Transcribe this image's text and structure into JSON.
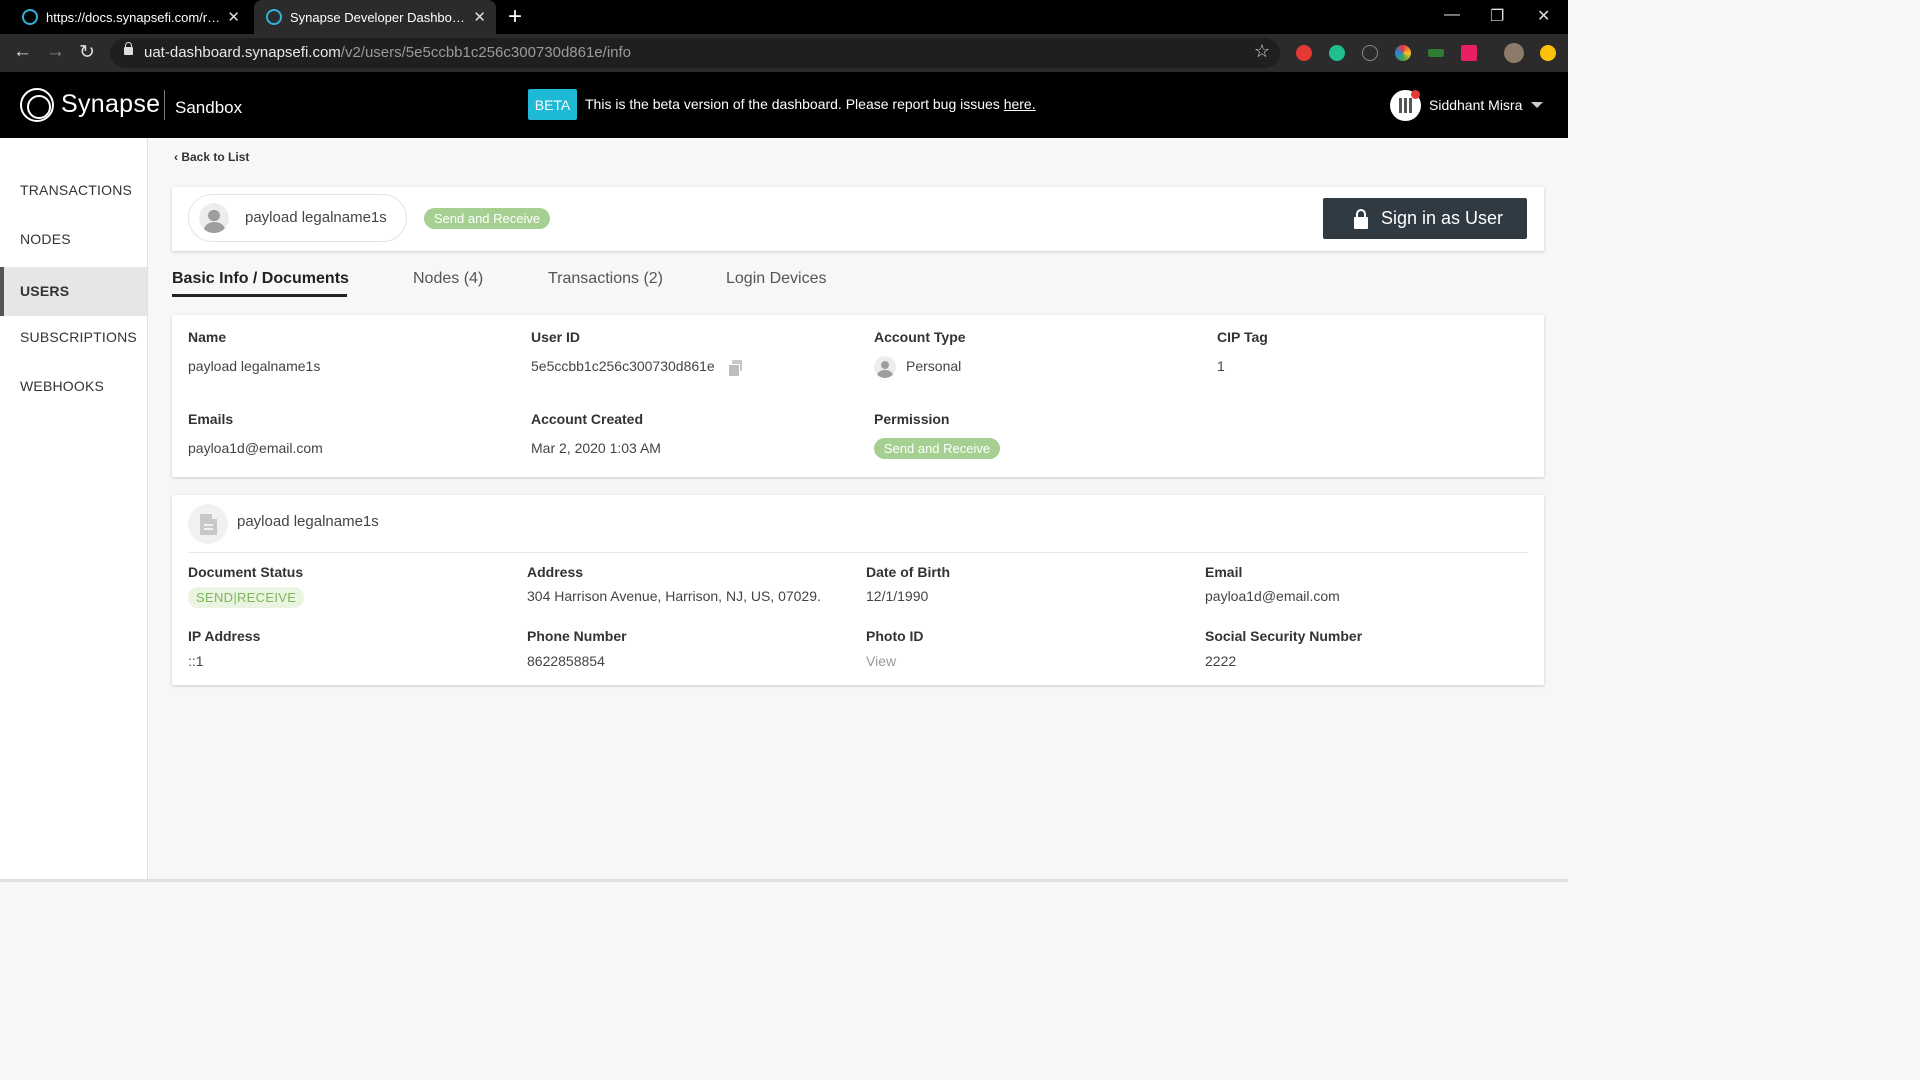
{
  "browser": {
    "tabs": [
      {
        "title": "https://docs.synapsefi.com/reference"
      },
      {
        "title": "Synapse Developer Dashboard"
      }
    ],
    "close_glyph": "✕",
    "new_tab_glyph": "+",
    "window_controls": {
      "minimize": "—",
      "restore": "❐",
      "close": "✕"
    },
    "nav": {
      "back": "←",
      "forward": "→",
      "reload": "↻"
    },
    "url_host": "uat-dashboard.synapsefi.com",
    "url_path": "/v2/users/5e5ccbb1c256c300730d861e/info",
    "bookmark_glyph": "☆",
    "extension_colors": [
      "#e53935",
      "#1fbf8f",
      "#4285f4",
      "#43a047",
      "#e91e63",
      "#ffc107"
    ]
  },
  "header": {
    "brand": "Synapse",
    "environment": "Sandbox",
    "beta_badge": "BETA",
    "beta_message": "This is the beta version of the dashboard. Please report bug issues ",
    "beta_link": "here.",
    "user_name": "Siddhant Misra",
    "accent_color": "#1db9d6"
  },
  "sidebar": {
    "items": [
      {
        "label": "TRANSACTIONS"
      },
      {
        "label": "NODES"
      },
      {
        "label": "USERS",
        "active": true
      },
      {
        "label": "SUBSCRIPTIONS"
      },
      {
        "label": "WEBHOOKS"
      }
    ]
  },
  "main": {
    "back_link": "Back to List",
    "summary": {
      "user_name": "payload legalname1s",
      "permission": "Send and Receive",
      "signin_button": "Sign in as User"
    },
    "tabs": [
      {
        "label": "Basic Info / Documents",
        "active": true
      },
      {
        "label": "Nodes (4)"
      },
      {
        "label": "Transactions (2)"
      },
      {
        "label": "Login Devices"
      }
    ],
    "info": {
      "name_label": "Name",
      "name_value": "payload legalname1s",
      "user_id_label": "User ID",
      "user_id_value": "5e5ccbb1c256c300730d861e",
      "account_type_label": "Account Type",
      "account_type_value": "Personal",
      "cip_tag_label": "CIP Tag",
      "cip_tag_value": "1",
      "emails_label": "Emails",
      "emails_value": "payloa1d@email.com",
      "account_created_label": "Account Created",
      "account_created_value": "Mar 2, 2020 1:03 AM",
      "permission_label": "Permission",
      "permission_value": "Send and Receive"
    },
    "document": {
      "title": "payload legalname1s",
      "status_label": "Document Status",
      "status_value": "SEND|RECEIVE",
      "address_label": "Address",
      "address_value": "304 Harrison Avenue, Harrison, NJ, US, 07029.",
      "dob_label": "Date of Birth",
      "dob_value": "12/1/1990",
      "email_label": "Email",
      "email_value": "payloa1d@email.com",
      "ip_label": "IP Address",
      "ip_value": "::1",
      "phone_label": "Phone Number",
      "phone_value": "8622858854",
      "photo_id_label": "Photo ID",
      "photo_id_value": "View",
      "ssn_label": "Social Security Number",
      "ssn_value": "2222"
    },
    "permission_color": "#a6cf92",
    "signin_color": "#2f3a43"
  }
}
